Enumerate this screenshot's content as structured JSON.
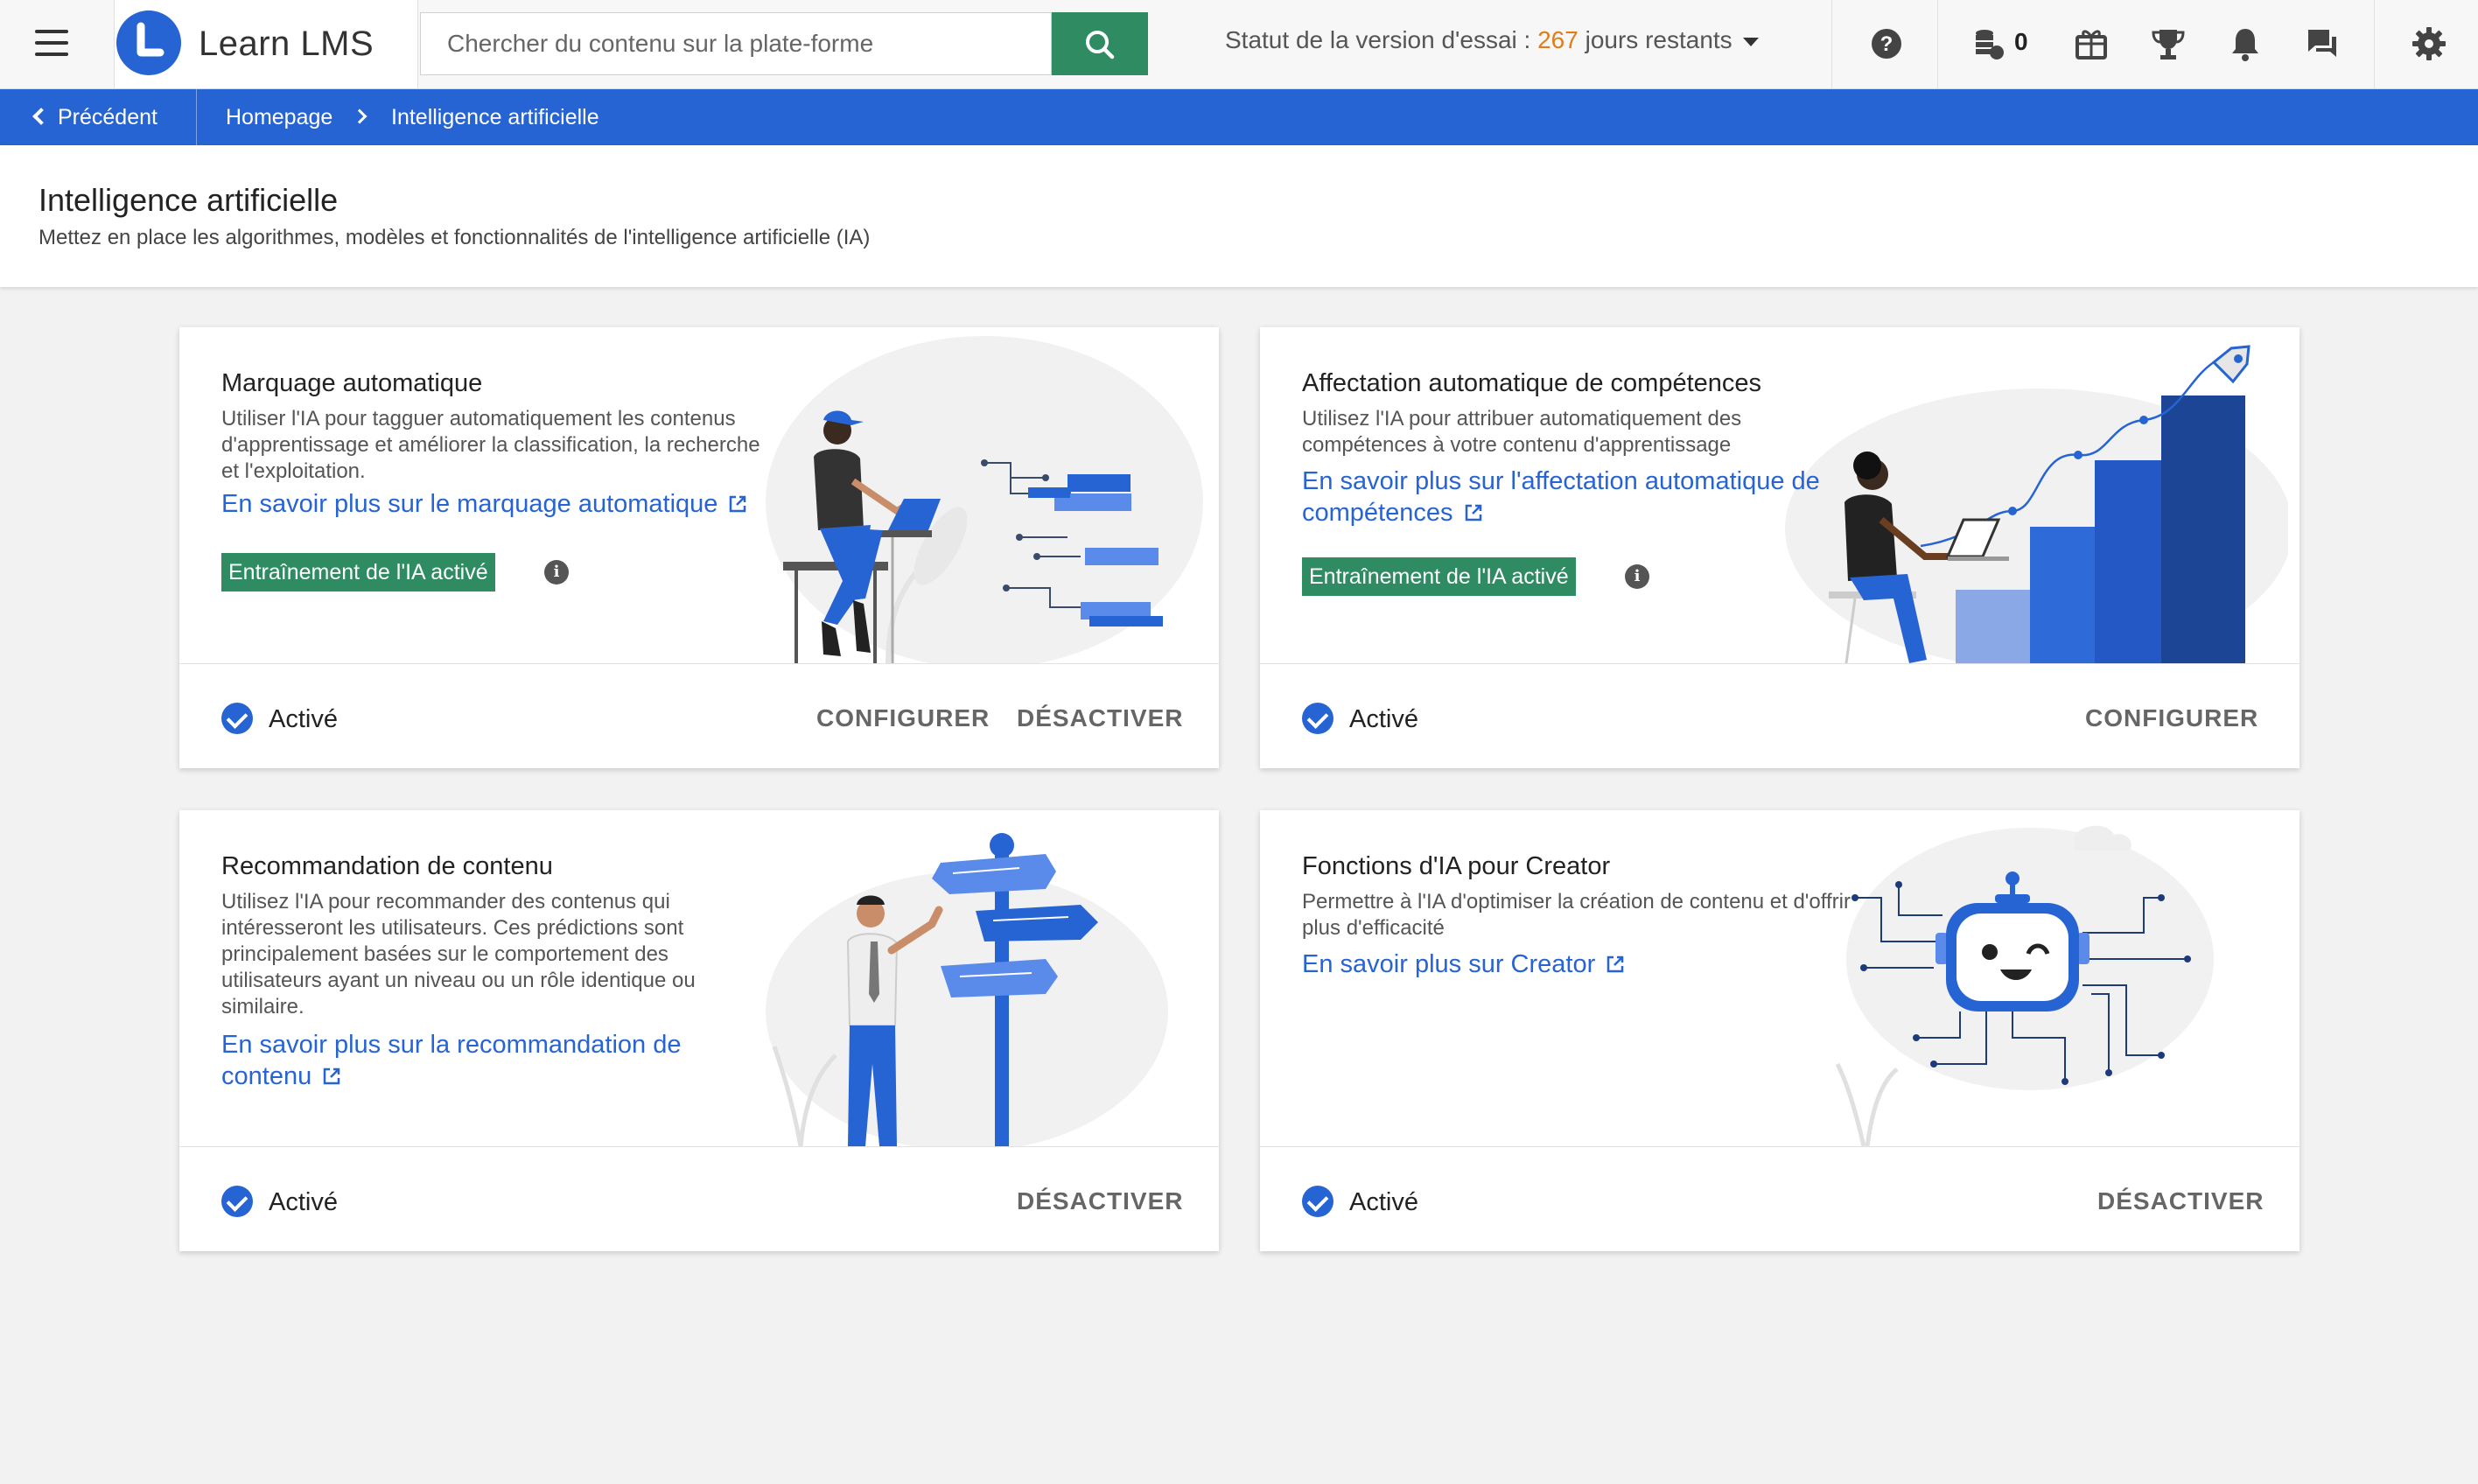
{
  "header": {
    "logo_text": "Learn LMS",
    "search_placeholder": "Chercher du contenu sur la plate-forme",
    "trial_prefix": "Statut de la version d'essai : ",
    "trial_days": "267",
    "trial_suffix": " jours restants",
    "coins_count": "0",
    "icons": [
      "menu-icon",
      "search-icon",
      "help-icon",
      "coins-icon",
      "gift-icon",
      "trophy-icon",
      "bell-icon",
      "chat-icon",
      "gear-icon"
    ]
  },
  "breadcrumb": {
    "back": "Précédent",
    "home": "Homepage",
    "current": "Intelligence artificielle"
  },
  "page": {
    "title": "Intelligence artificielle",
    "subtitle": "Mettez en place les algorithmes, modèles et fonctionnalités de l'intelligence artificielle (IA)"
  },
  "cards": [
    {
      "title": "Marquage automatique",
      "description": "Utiliser l'IA pour tagguer automatiquement les contenus d'apprentissage et améliorer la classification, la recherche et l'exploitation.",
      "link": "En savoir plus sur le marquage automatique",
      "badge": "Entraînement de l'IA activé",
      "status": "Activé",
      "actions": [
        "CONFIGURER",
        "DÉSACTIVER"
      ]
    },
    {
      "title": "Affectation automatique de compétences",
      "description": "Utilisez l'IA pour attribuer automatiquement des compétences à votre contenu d'apprentissage",
      "link_line1": "En savoir plus sur l'affectation automatique de",
      "link_line2": "compétences",
      "badge": "Entraînement de l'IA activé",
      "status": "Activé",
      "actions": [
        "CONFIGURER"
      ]
    },
    {
      "title": "Recommandation de contenu",
      "description": "Utilisez l'IA pour recommander des contenus qui intéresseront les utilisateurs. Ces prédictions sont principalement basées sur le comportement des utilisateurs ayant un niveau ou un rôle identique ou similaire.",
      "link_line1": "En savoir plus sur la recommandation de",
      "link_line2": "contenu",
      "status": "Activé",
      "actions": [
        "DÉSACTIVER"
      ]
    },
    {
      "title": "Fonctions d'IA pour Creator",
      "description": "Permettre à l'IA d'optimiser la création de contenu et d'offrir plus d'efficacité",
      "link": "En savoir plus sur Creator",
      "status": "Activé",
      "actions": [
        "DÉSACTIVER"
      ]
    }
  ],
  "colors": {
    "brand_blue": "#2764d3",
    "green": "#2e8b62",
    "trial_orange": "#e07c1c"
  }
}
